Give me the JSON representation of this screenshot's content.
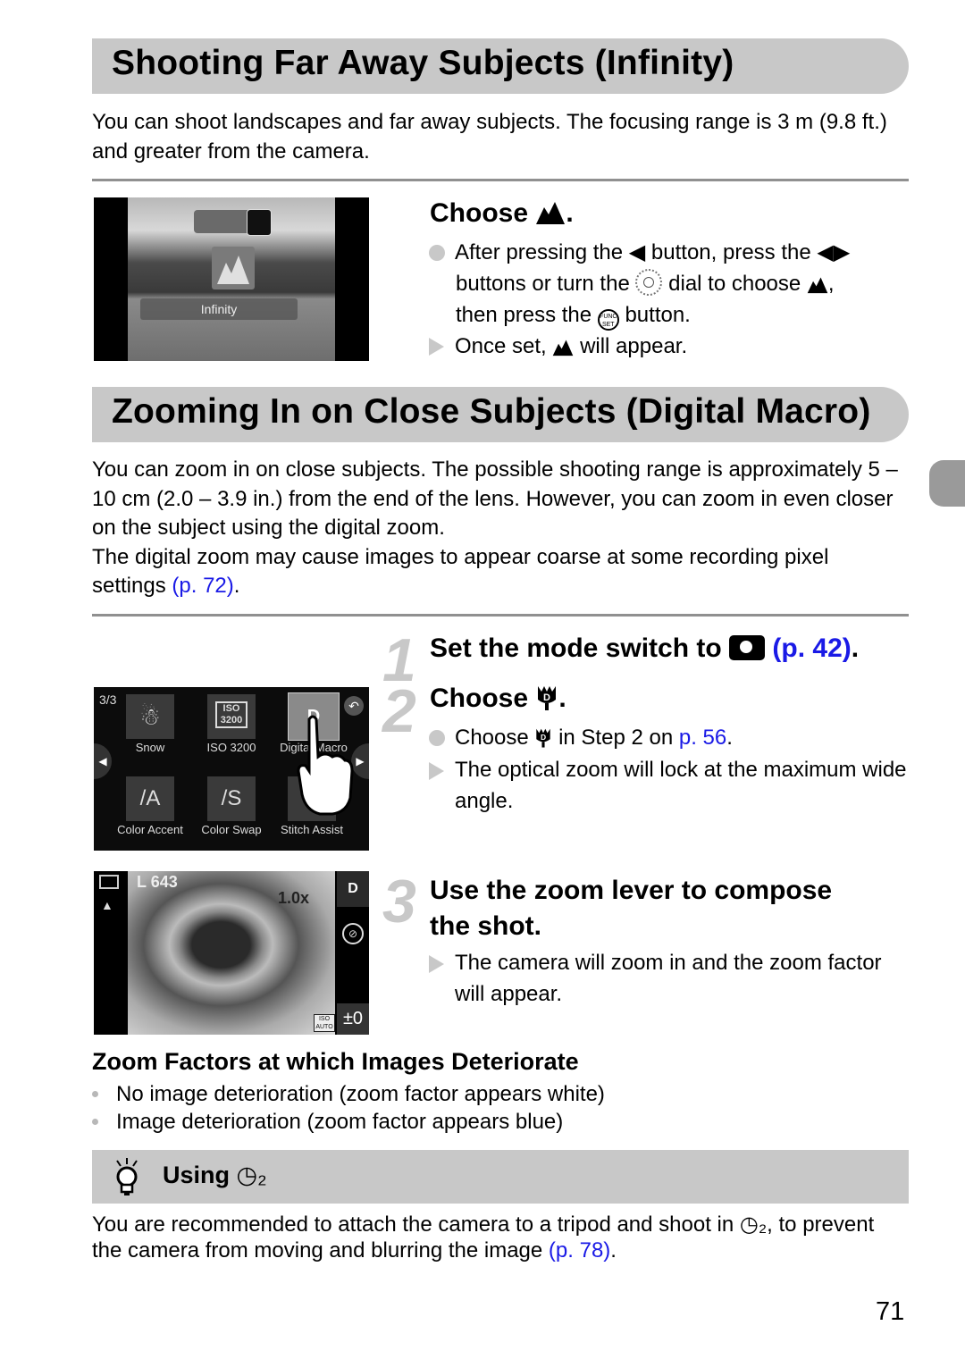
{
  "section1": {
    "title": "Shooting Far Away Subjects (Infinity)",
    "intro": "You can shoot landscapes and far away subjects. The focusing range is 3 m (9.8 ft.) and greater from the camera.",
    "screen": {
      "label": "Infinity"
    },
    "step_title": "Choose",
    "bullets": [
      {
        "type": "action",
        "parts": [
          "After pressing the",
          "button, press the",
          "buttons or turn the",
          "dial to choose",
          ",",
          "then press the",
          "button."
        ]
      },
      {
        "type": "result",
        "parts": [
          "Once set,",
          "will appear."
        ]
      }
    ]
  },
  "section2": {
    "title": "Zooming In on Close Subjects (Digital Macro)",
    "intro_lines": [
      "You can zoom in on close subjects. The possible shooting range is approximately 5 – 10 cm (2.0 – 3.9 in.) from the end of the lens. However, you can zoom in even closer on the subject using the digital zoom.",
      "The digital zoom may cause images to appear coarse at some recording pixel settings"
    ],
    "intro_link": "(p. 72)",
    "steps": [
      {
        "num": "1",
        "text": "Set the mode switch to",
        "link": "(p. 42)"
      },
      {
        "num": "2",
        "text": "Choose",
        "bullets": [
          {
            "type": "action",
            "before": "Choose",
            "after": "in Step 2 on",
            "link": "p. 56"
          },
          {
            "type": "result",
            "text": "The optical zoom will lock at the maximum wide angle."
          }
        ]
      },
      {
        "num": "3",
        "text_lines": [
          "Use the zoom lever to compose",
          "the shot."
        ],
        "bullets": [
          {
            "type": "result",
            "text": "The camera will zoom in and the zoom factor will appear."
          }
        ]
      }
    ],
    "menu_screen": {
      "page": "3/3",
      "tiles": [
        "Snow",
        "ISO 3200",
        "Digital Macro",
        "Color Accent",
        "Color Swap",
        "Stitch Assist"
      ],
      "iso_top": "ISO",
      "iso_bottom": "3200"
    },
    "shoot_screen": {
      "quality": "L",
      "shots": "643",
      "zoom": "1.0x",
      "exposure": "±0",
      "iso": "ISO AUTO"
    },
    "zoom_factors": {
      "title": "Zoom Factors at which Images Deteriorate",
      "items": [
        "No image deterioration (zoom factor appears white)",
        "Image deterioration (zoom factor appears blue)"
      ]
    },
    "tip": {
      "title": "Using",
      "text_before": "You are recommended to attach the camera to a tripod and shoot in",
      "text_after": ", to prevent the camera from moving and blurring the image",
      "link": "(p. 78)"
    }
  },
  "page_number": "71"
}
